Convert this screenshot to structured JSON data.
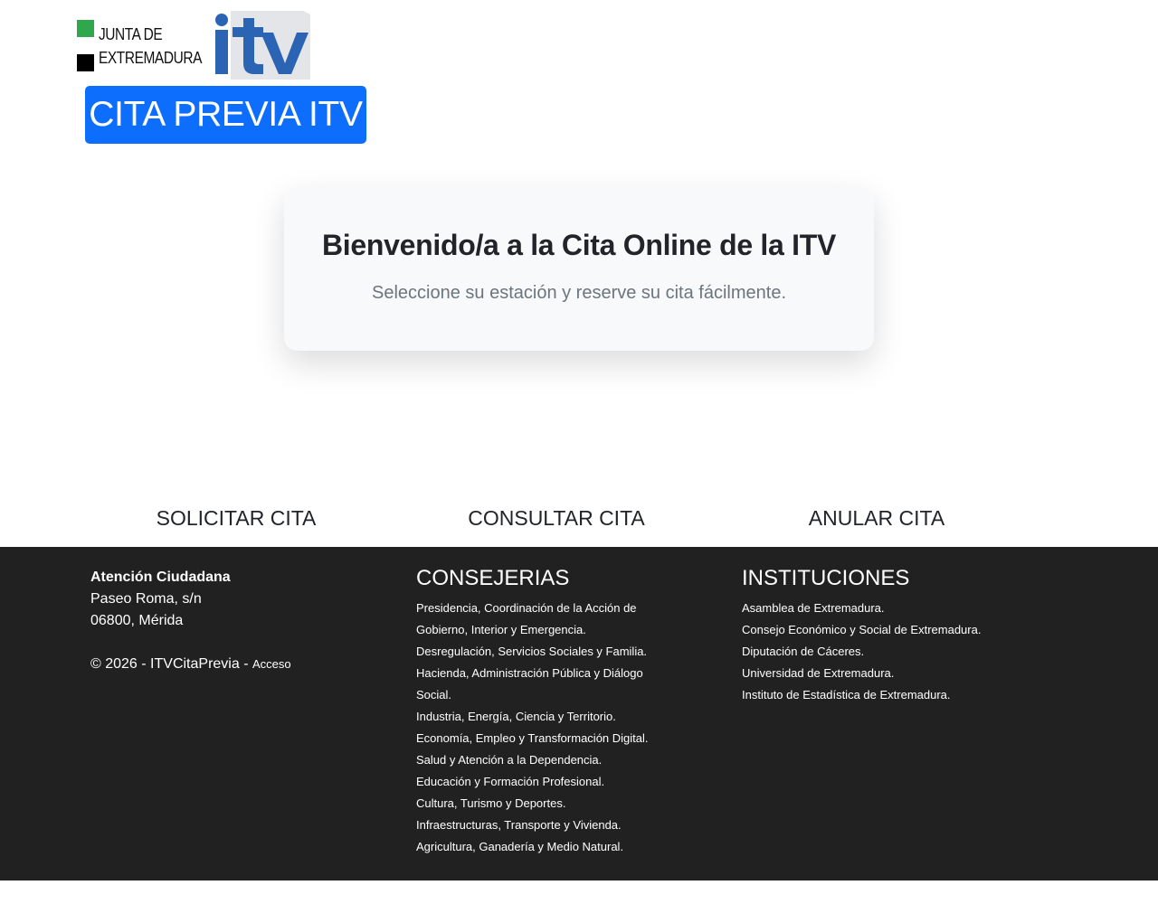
{
  "header": {
    "junta_logo_line1": "JUNTA  DE",
    "junta_logo_line2": "EXTREMADURA",
    "itv_logo_text": "itv",
    "brand_label": "CITA PREVIA ITV"
  },
  "welcome": {
    "title": "Bienvenido/a a la Cita Online de la ITV",
    "subtitle": "Seleccione su estación y reserve su cita fácilmente."
  },
  "actions": [
    {
      "label": "SOLICITAR CITA"
    },
    {
      "label": "CONSULTAR CITA"
    },
    {
      "label": "ANULAR CITA"
    }
  ],
  "footer": {
    "contact": {
      "title": "Atención Ciudadana",
      "address_line1": "Paseo Roma, s/n",
      "address_line2": "06800, Mérida",
      "copyright": "© 2026 - ITVCitaPrevia - ",
      "access_label": "Acceso"
    },
    "consejerias": {
      "heading": "CONSEJERIAS",
      "items": [
        "Presidencia, Coordinación de la Acción de Gobierno, Interior y Emergencia.",
        "Desregulación, Servicios Sociales y Familia.",
        "Hacienda, Administración Pública y Diálogo Social.",
        "Industria, Energía, Ciencia y Territorio.",
        "Economía, Empleo y Transformación Digital.",
        "Salud y Atención a la Dependencia.",
        "Educación y Formación Profesional.",
        "Cultura, Turismo y Deportes.",
        "Infraestructuras, Transporte y Vivienda.",
        "Agricultura, Ganadería y Medio Natural."
      ]
    },
    "instituciones": {
      "heading": "INSTITUCIONES",
      "items": [
        "Asamblea de Extremadura.",
        "Consejo Económico y Social de Extremadura.",
        "Diputación de Cáceres.",
        "Universidad de Extremadura.",
        "Instituto de Estadística de Extremadura."
      ]
    }
  },
  "colors": {
    "brand_blue": "#0d6efd",
    "junta_green": "#2ea84a",
    "itv_blue": "#2c64b4",
    "footer_bg": "#212121"
  }
}
